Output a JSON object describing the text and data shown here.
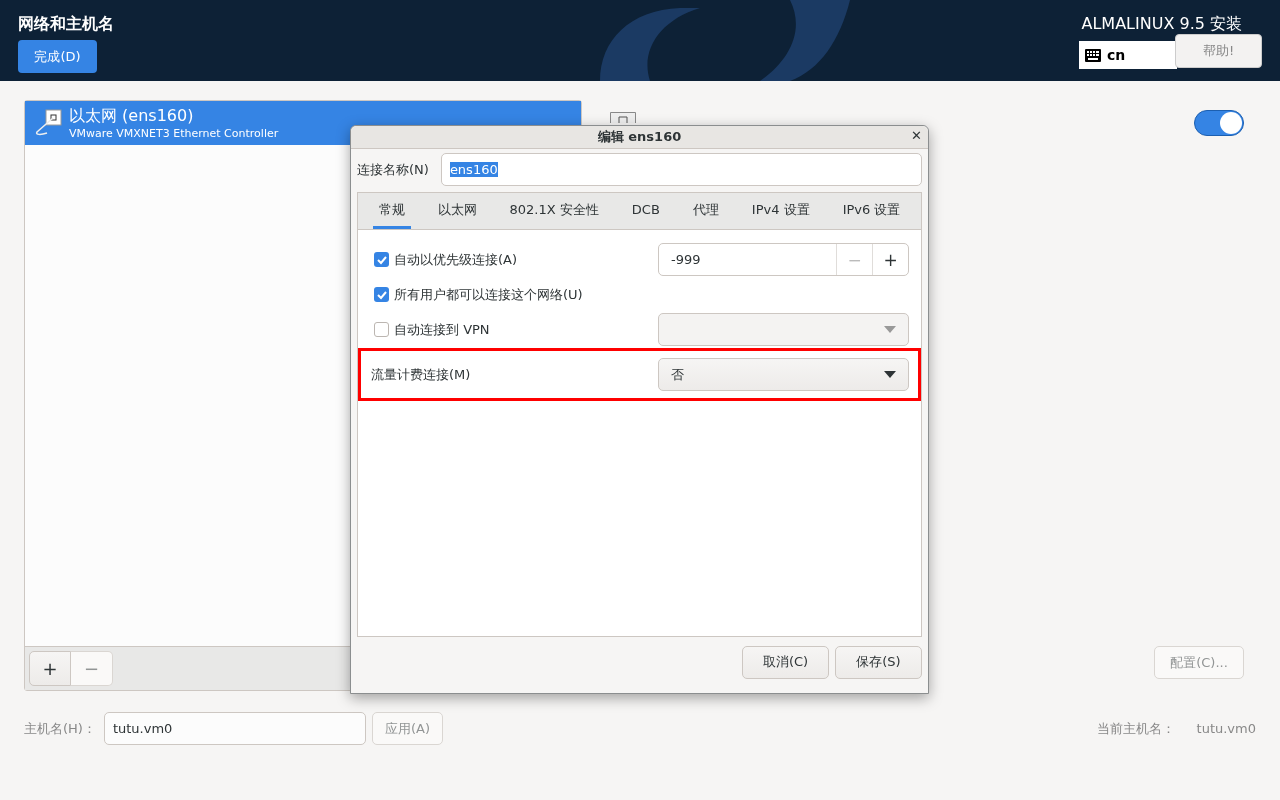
{
  "header": {
    "title": "网络和主机名",
    "done_button": "完成(D)",
    "product": "ALMALINUX 9.5 安装",
    "keyboard_layout": "cn",
    "help_button": "帮助!"
  },
  "connections": {
    "items": [
      {
        "name": "以太网 (ens160)",
        "description": "VMware VMXNET3 Ethernet Controller",
        "selected": true
      }
    ],
    "buttons": [
      {
        "label": "+",
        "disabled": false
      },
      {
        "label": "−",
        "disabled": true
      }
    ]
  },
  "detail": {
    "on": true,
    "configure_button": {
      "label": "配置(C)...",
      "disabled": true
    }
  },
  "hostname": {
    "label": "主机名(H)：",
    "value": "tutu.vm0",
    "apply_button": {
      "label": "应用(A)",
      "disabled": true
    },
    "current_label": "当前主机名：",
    "current_value": "tutu.vm0"
  },
  "dialog": {
    "title": "编辑 ens160",
    "close": "✕",
    "connection_name_label": "连接名称(N)",
    "connection_name": "ens160",
    "connection_name_text_selected": true,
    "tabs": [
      {
        "label": "常规",
        "selected": true
      },
      {
        "label": "以太网",
        "selected": false
      },
      {
        "label": "802.1X 安全性",
        "selected": false
      },
      {
        "label": "DCB",
        "selected": false
      },
      {
        "label": "代理",
        "selected": false
      },
      {
        "label": "IPv4 设置",
        "selected": false
      },
      {
        "label": "IPv6 设置",
        "selected": false
      }
    ],
    "rows": [
      {
        "kind": "checkbox-spin",
        "label": "自动以优先级连接(A)",
        "checked": true,
        "value": "-999",
        "spin_buttons": [
          {
            "label": "−",
            "disabled": true
          },
          {
            "label": "+",
            "disabled": false
          }
        ]
      },
      {
        "kind": "checkbox",
        "label": "所有用户都可以连接这个网络(U)",
        "checked": true
      },
      {
        "kind": "checkbox-combo",
        "label": "自动连接到 VPN",
        "checked": false,
        "combo_disabled": true
      },
      {
        "kind": "combo",
        "label": "流量计费连接(M)",
        "value": "否",
        "highlighted": true
      }
    ],
    "buttons": [
      "取消(C)",
      "保存(S)"
    ]
  }
}
